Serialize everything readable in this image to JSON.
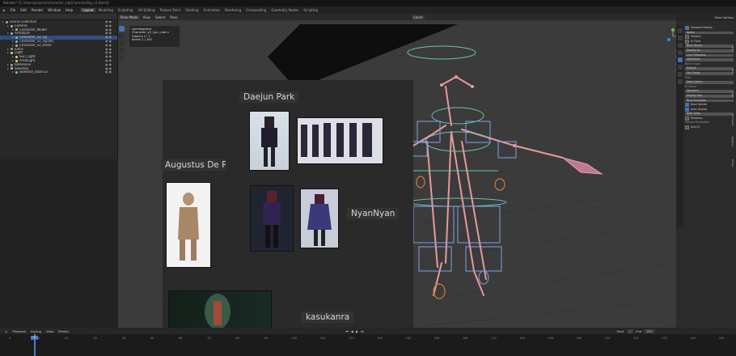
{
  "window": {
    "title": "Blender* [C:\\Users\\projects\\character_rig\\CharacterRig_v2.blend]"
  },
  "menu": [
    "File",
    "Edit",
    "Render",
    "Window",
    "Help"
  ],
  "workspaces": [
    "Layout",
    "Modeling",
    "Sculpting",
    "UV Editing",
    "Texture Paint",
    "Shading",
    "Animation",
    "Rendering",
    "Compositing",
    "Geometry Nodes",
    "Scripting"
  ],
  "active_workspace": "Layout",
  "viewport_header": {
    "mode": "Pose Mode",
    "items": [
      "View",
      "Select",
      "Pose"
    ],
    "transform": "Local"
  },
  "outliner": {
    "rows": [
      {
        "label": "Scene Collection",
        "level": 0,
        "color": "#9a9a9a"
      },
      {
        "label": "Camera",
        "level": 1,
        "color": "#7fb0d8"
      },
      {
        "label": "Character_Model",
        "level": 2,
        "color": "#d89b5a"
      },
      {
        "label": "Armature",
        "level": 1,
        "color": "#7fb0d8"
      },
      {
        "label": "Character_v2_rig",
        "level": 2,
        "color": "#5ec3b0",
        "selected": true
      },
      {
        "label": "Character_v2_rig.001",
        "level": 2,
        "color": "#5ec3b0"
      },
      {
        "label": "Character_v2_mesh",
        "level": 2,
        "color": "#d89b5a"
      },
      {
        "label": "Extra",
        "level": 1,
        "color": "#9a9a9a"
      },
      {
        "label": "Light",
        "level": 1,
        "color": "#e5c07b"
      },
      {
        "label": "Sun_Light",
        "level": 2,
        "color": "#e5c07b"
      },
      {
        "label": "AreaLight",
        "level": 2,
        "color": "#e5c07b"
      },
      {
        "label": "Reference",
        "level": 1,
        "color": "#9a9a9a"
      },
      {
        "label": "Skeleton",
        "level": 1,
        "color": "#7fb0d8"
      },
      {
        "label": "Skeleton_base.v2",
        "level": 2,
        "color": "#5ec3b0"
      }
    ]
  },
  "operator_panel": {
    "title": "UserNegative",
    "subtitle": "Character_v2_rig.c_root.x",
    "lines": [
      "Objects  1 / 1",
      "Bones  1 / 183"
    ]
  },
  "reference_labels": [
    "Daejun Park",
    "Augustus De Prima Porta",
    "NyanNyan",
    "kasukanra"
  ],
  "properties": {
    "header": "Pose Options",
    "rows": [
      {
        "type": "check",
        "label": "Viewport Display",
        "on": true
      },
      {
        "type": "field",
        "label": "Name"
      },
      {
        "type": "check",
        "label": "Shadow",
        "on": false
      },
      {
        "type": "check",
        "label": "In Front",
        "on": false
      },
      {
        "type": "field",
        "label": "Bone Shape"
      },
      {
        "type": "field",
        "label": "Display As"
      },
      {
        "type": "field",
        "label": "Line Thickness"
      },
      {
        "type": "field",
        "label": "Wireframe"
      },
      {
        "type": "label",
        "label": "Bone Group"
      },
      {
        "type": "field",
        "label": "Default"
      },
      {
        "type": "field",
        "label": "Set Group"
      },
      {
        "type": "label",
        "label": "Pose"
      },
      {
        "type": "field",
        "label": "Pose Library"
      },
      {
        "type": "label",
        "label": "IK Solver"
      },
      {
        "type": "field",
        "label": "Standard"
      },
      {
        "type": "field",
        "label": "Display Size"
      },
      {
        "type": "field",
        "label": "Bone Envelope"
      },
      {
        "type": "check",
        "label": "Bone Names",
        "on": true
      },
      {
        "type": "check",
        "label": "Axes Display",
        "on": true
      },
      {
        "type": "field",
        "label": "Both Sides"
      },
      {
        "type": "check",
        "label": "Relations",
        "on": false
      },
      {
        "type": "label",
        "label": "Inverse Kinematics"
      },
      {
        "type": "check",
        "label": "Auto IK",
        "on": false
      }
    ],
    "vertical_tabs": [
      "Item",
      "Tool",
      "View",
      "Animation",
      "Rigging",
      "Extras"
    ]
  },
  "timeline": {
    "menus": [
      "Playback",
      "Keying",
      "View",
      "Marker"
    ],
    "current_frame": "6",
    "ticks": [
      "0",
      "10",
      "20",
      "30",
      "40",
      "50",
      "60",
      "70",
      "80",
      "90",
      "100",
      "110",
      "120",
      "130",
      "140",
      "150",
      "160",
      "170",
      "180",
      "190",
      "200",
      "210",
      "220",
      "230",
      "240",
      "250"
    ],
    "right": [
      "Start",
      "1",
      "End",
      "250"
    ]
  },
  "colors": {
    "accent": "#4772b3",
    "bone": "#e89a9a",
    "ik_control": "#6ec1b0",
    "fk_control": "#7fa0e8"
  }
}
